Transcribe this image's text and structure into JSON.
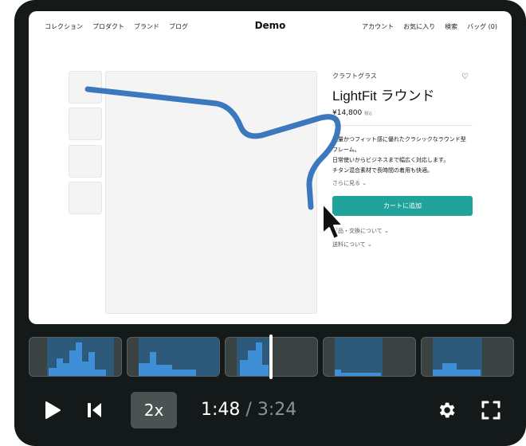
{
  "screen": {
    "nav_left": [
      "コレクション",
      "プロダクト",
      "ブランド",
      "ブログ"
    ],
    "brand": "Demo",
    "nav_right": [
      "アカウント",
      "お気に入り",
      "検索",
      "バッグ (0)"
    ],
    "product": {
      "eyebrow": "クラフトグラス",
      "title": "LightFit ラウンド",
      "price": "¥14,800",
      "tax": "税込",
      "desc": [
        "軽量かつフィット感に優れたクラシックなラウンド型",
        "フレーム。",
        "日常使いからビジネスまで幅広く対応します。",
        "チタン混合素材で長時間の着用も快適。"
      ],
      "more": "さらに見る ⌄",
      "cart": "カートに追加",
      "returns": "返品・交換について ⌄",
      "shipping": "送料について ⌄"
    }
  },
  "player": {
    "speed": "2x",
    "current_time": "1:48",
    "separator": "/",
    "total_time": "3:24",
    "accent": "#3f8fd6",
    "cart_color": "#20a39a",
    "annotation_color": "#3c78be"
  }
}
